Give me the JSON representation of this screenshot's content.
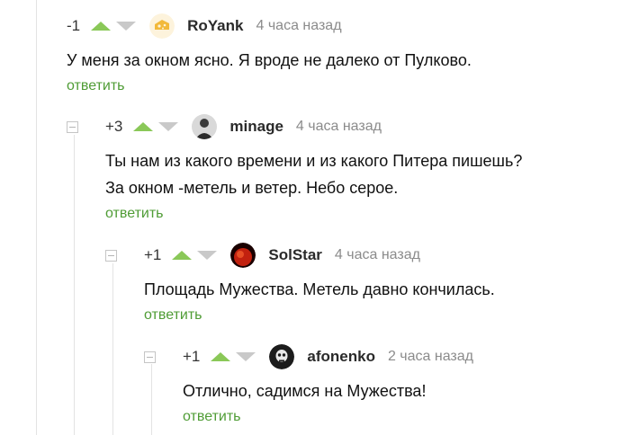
{
  "comments": [
    {
      "rating": "-1",
      "author": "RoYank",
      "time": "4 часа назад",
      "lines": [
        "У меня за окном ясно. Я вроде не далеко от Пулково."
      ],
      "reply": "ответить",
      "avatar_icon": "cheese-avatar"
    },
    {
      "rating": "+3",
      "author": "minage",
      "time": "4 часа назад",
      "lines": [
        "Ты нам из какого времени и из какого Питера пишешь?",
        "За окном -метель и ветер. Небо серое."
      ],
      "reply": "ответить",
      "avatar_icon": "person-avatar"
    },
    {
      "rating": "+1",
      "author": "SolStar",
      "time": "4 часа назад",
      "lines": [
        "Площадь Мужества. Метель давно кончилась."
      ],
      "reply": "ответить",
      "avatar_icon": "red-planet-avatar"
    },
    {
      "rating": "+1",
      "author": "afonenko",
      "time": "2 часа назад",
      "lines": [
        "Отлично, садимся на Мужества!"
      ],
      "reply": "ответить",
      "avatar_icon": "skull-avatar"
    }
  ],
  "colors": {
    "vote_up": "#8ac858",
    "vote_down": "#c9c9c9",
    "reply_link": "#4f9c35",
    "time_text": "#8b8b8b",
    "thread_line": "#e3e3e3"
  }
}
